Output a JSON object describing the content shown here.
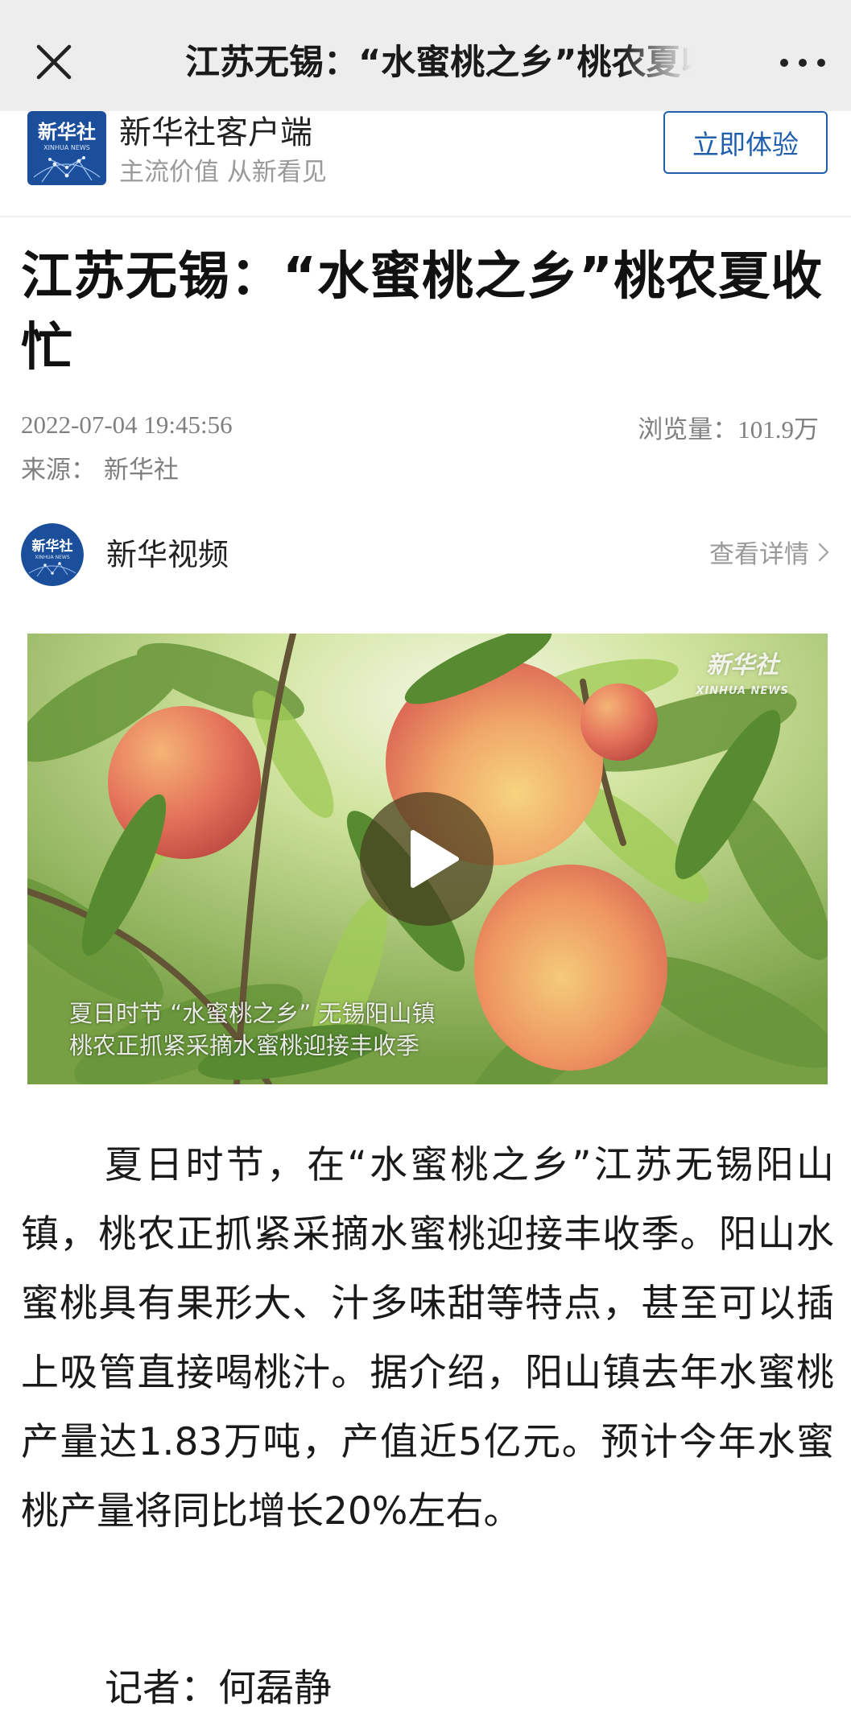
{
  "topbar": {
    "title": "江苏无锡：“水蜜桃之乡”桃农夏收忙",
    "close_icon": "close-icon",
    "more_icon": "more-dots-icon"
  },
  "banner": {
    "logo_text": "新华社",
    "logo_sub": "XINHUA NEWS",
    "app_name": "新华社客户端",
    "slogan": "主流价值 从新看见",
    "cta_label": "立即体验"
  },
  "article": {
    "title": "江苏无锡：“水蜜桃之乡”桃农夏收忙",
    "datetime": "2022-07-04 19:45:56",
    "views_label": "浏览量：",
    "views_value": "101.9万",
    "source": "来源：  新华社"
  },
  "channel": {
    "logo_text": "新华社",
    "logo_sub": "XINHUA NEWS",
    "name": "新华视频",
    "detail_label": "查看详情"
  },
  "video": {
    "watermark": "新华社",
    "watermark_sub": "XINHUA NEWS",
    "caption_line1": "夏日时节 “水蜜桃之乡” 无锡阳山镇",
    "caption_line2": "桃农正抓紧采摘水蜜桃迎接丰收季",
    "play_icon": "play-icon"
  },
  "body": {
    "paragraph": "夏日时节，在“水蜜桃之乡”江苏无锡阳山镇，桃农正抓紧采摘水蜜桃迎接丰收季。阳山水蜜桃具有果形大、汁多味甜等特点，甚至可以插上吸管直接喝桃汁。据介绍，阳山镇去年水蜜桃产量达1.83万吨，产值近5亿元。预计今年水蜜桃产量将同比增长20%左右。",
    "reporter": "记者：何磊静"
  },
  "colors": {
    "topbar_bg": "#ededed",
    "brand_blue": "#1f5fae",
    "meta_gray": "#808080"
  }
}
